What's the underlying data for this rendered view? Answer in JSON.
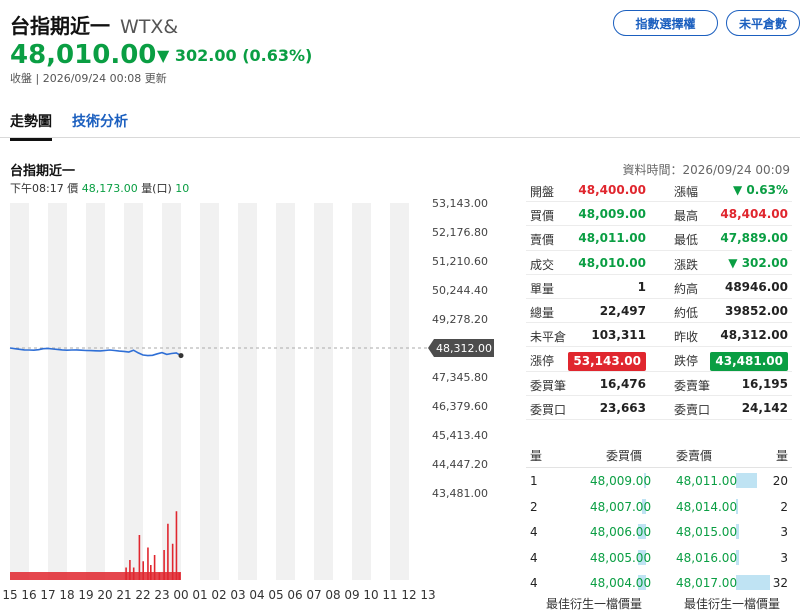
{
  "header": {
    "title": "台指期近一",
    "code": "WTX&",
    "price": "48,010.00",
    "change": "302.00 (0.63%)",
    "status": "收盤 | 2026/09/24 00:08 更新",
    "buttons": [
      "指數選擇權",
      "未平倉數"
    ]
  },
  "tabs": [
    "走勢圖",
    "技術分析"
  ],
  "chart_info": {
    "title": "台指期近一",
    "time_label": "下午08:17",
    "price_label": "價",
    "price_value": "48,173.00",
    "volume_label": "量(口)",
    "volume_value": "10",
    "data_time": "資料時間：2026/09/24 00:09"
  },
  "chart_data": {
    "type": "line",
    "x_ticks": [
      "15",
      "16",
      "17",
      "18",
      "19",
      "20",
      "21",
      "22",
      "23",
      "00",
      "01",
      "02",
      "03",
      "04",
      "05",
      "06",
      "07",
      "08",
      "09",
      "10",
      "11",
      "12",
      "13"
    ],
    "y_ticks": [
      "53,143.00",
      "52,176.80",
      "51,210.60",
      "50,244.40",
      "49,278.20",
      "48,312.00",
      "47,345.80",
      "46,379.60",
      "45,413.40",
      "44,447.20",
      "43,481.00"
    ],
    "ylim": [
      43481,
      53143
    ],
    "reference": 48312,
    "reference_label": "48,312.00",
    "series": [
      {
        "x": [
          0,
          0.25,
          0.5,
          0.75,
          1,
          1.25,
          1.5,
          1.75,
          2,
          2.25,
          2.5,
          2.75,
          3,
          3.25,
          3.5,
          3.75,
          4,
          4.25,
          4.5,
          4.75,
          5,
          5.25,
          5.5,
          5.75,
          6,
          6.25,
          6.5,
          6.75,
          7,
          7.25,
          7.5,
          7.75,
          8,
          8.25,
          8.5,
          8.75,
          9
        ],
        "y": [
          48312,
          48290,
          48270,
          48250,
          48245,
          48240,
          48255,
          48290,
          48300,
          48280,
          48265,
          48250,
          48240,
          48245,
          48250,
          48240,
          48230,
          48225,
          48220,
          48215,
          48230,
          48245,
          48230,
          48210,
          48200,
          48180,
          48240,
          48150,
          48080,
          48060,
          48070,
          48120,
          48160,
          48100,
          48130,
          48150,
          48060
        ]
      }
    ],
    "volume": {
      "x": [
        6.1,
        6.3,
        6.5,
        6.8,
        7.0,
        7.25,
        7.4,
        7.6,
        7.85,
        8.1,
        8.3,
        8.55,
        8.75,
        8.9
      ],
      "values": [
        1,
        1.6,
        1,
        3.6,
        1.5,
        2.6,
        1.2,
        2,
        0.6,
        2.4,
        4.5,
        2.9,
        5.5,
        0.6
      ]
    }
  },
  "stats": [
    {
      "l1": "開盤",
      "v1": "48,400.00",
      "c1": "red",
      "l2": "漲幅",
      "v2": "0.63%",
      "c2": "green",
      "arrow2": true
    },
    {
      "l1": "買價",
      "v1": "48,009.00",
      "c1": "green",
      "l2": "最高",
      "v2": "48,404.00",
      "c2": "red"
    },
    {
      "l1": "賣價",
      "v1": "48,011.00",
      "c1": "green",
      "l2": "最低",
      "v2": "47,889.00",
      "c2": "green"
    },
    {
      "l1": "成交",
      "v1": "48,010.00",
      "c1": "green",
      "l2": "漲跌",
      "v2": "302.00",
      "c2": "green",
      "arrow2": true
    },
    {
      "l1": "單量",
      "v1": "1",
      "c1": "",
      "l2": "約高",
      "v2": "48946.00",
      "c2": ""
    },
    {
      "l1": "總量",
      "v1": "22,497",
      "c1": "",
      "l2": "約低",
      "v2": "39852.00",
      "c2": ""
    },
    {
      "l1": "未平倉",
      "v1": "103,311",
      "c1": "",
      "l2": "昨收",
      "v2": "48,312.00",
      "c2": ""
    },
    {
      "l1": "漲停",
      "v1": "53,143.00",
      "c1": "badge-red",
      "l2": "跌停",
      "v2": "43,481.00",
      "c2": "badge-green"
    },
    {
      "l1": "委買筆",
      "v1": "16,476",
      "c1": "",
      "l2": "委賣筆",
      "v2": "16,195",
      "c2": ""
    },
    {
      "l1": "委買口",
      "v1": "23,663",
      "c1": "",
      "l2": "委賣口",
      "v2": "24,142",
      "c2": ""
    }
  ],
  "orderbook": {
    "headers": [
      "量",
      "委買價",
      "委賣價",
      "量"
    ],
    "rows": [
      {
        "bq": "1",
        "bp": "48,009.00",
        "ap": "48,011.00",
        "aq": "20",
        "bfill": 0.03,
        "afill": 0.63
      },
      {
        "bq": "2",
        "bp": "48,007.00",
        "ap": "48,014.00",
        "aq": "2",
        "bfill": 0.06,
        "afill": 0.06
      },
      {
        "bq": "4",
        "bp": "48,006.00",
        "ap": "48,015.00",
        "aq": "3",
        "bfill": 0.13,
        "afill": 0.09
      },
      {
        "bq": "4",
        "bp": "48,005.00",
        "ap": "48,016.00",
        "aq": "3",
        "bfill": 0.13,
        "afill": 0.09
      },
      {
        "bq": "4",
        "bp": "48,004.00",
        "ap": "48,017.00",
        "aq": "32",
        "bfill": 0.13,
        "afill": 1.0
      }
    ],
    "footer": [
      "最佳衍生一檔價量",
      "最佳衍生一檔價量"
    ]
  },
  "colors": {
    "up": "#e0262e",
    "down": "#0a9e43",
    "line": "#2f6fd6",
    "link": "#1b5fbf"
  }
}
